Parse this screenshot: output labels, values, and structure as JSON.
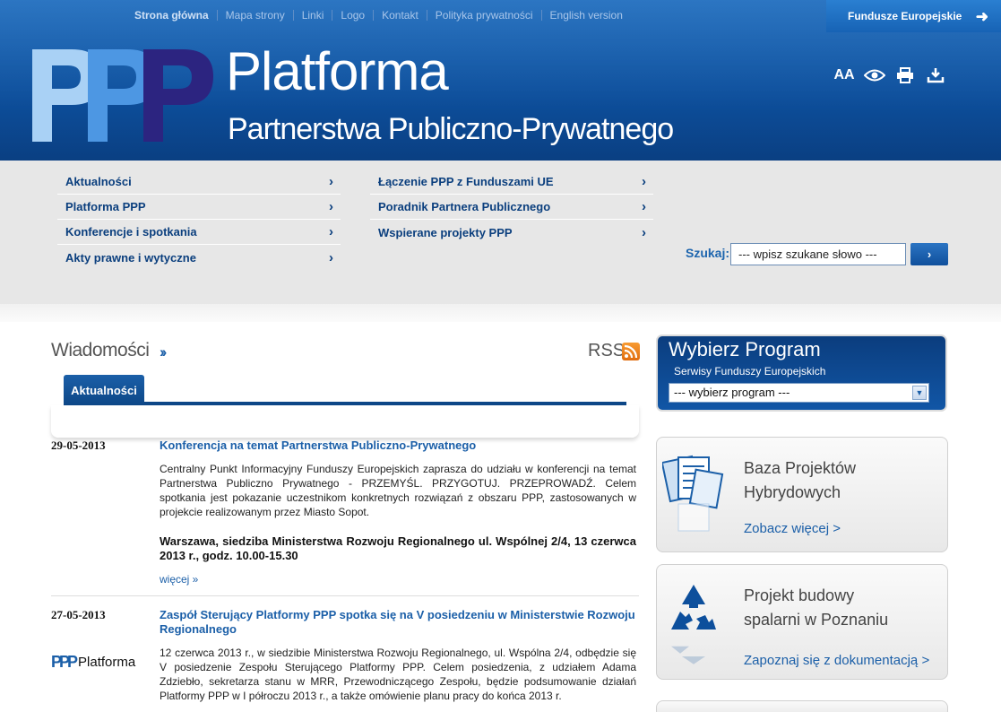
{
  "topnav": {
    "items": [
      "Strona główna",
      "Mapa strony",
      "Linki",
      "Logo",
      "Kontakt",
      "Polityka prywatności",
      "English version"
    ]
  },
  "fundusze": {
    "label": "Fundusze Europejskie"
  },
  "logo": {
    "line1": "Platforma",
    "line2": "Partnerstwa Publiczno-Prywatnego"
  },
  "tools": {
    "font_size": "AA",
    "icons": [
      "font-size-icon",
      "eye-icon",
      "print-icon",
      "download-icon"
    ]
  },
  "menu": {
    "left": [
      "Aktualności",
      "Platforma PPP",
      "Konferencje i spotkania",
      "Akty prawne i wytyczne"
    ],
    "right": [
      "Łączenie PPP z Funduszami UE",
      "Poradnik Partnera Publicznego",
      "Wspierane projekty PPP"
    ]
  },
  "search": {
    "label": "Szukaj:",
    "value": "--- wpisz szukane słowo ---",
    "button": "›"
  },
  "news": {
    "heading": "Wiadomości",
    "rss": "RSS",
    "tab": "Aktualności",
    "items": [
      {
        "date": "29-05-2013",
        "title": "Konferencja na temat Partnerstwa Publiczno-Prywatnego",
        "body": "Centralny Punkt Informacyjny Funduszy Europejskich zaprasza do udziału w konferencji na temat Partnerstwa Publiczno Prywatnego - PRZEMYŚL. PRZYGOTUJ. PRZEPROWADŹ. Celem spotkania jest pokazanie uczestnikom konkretnych rozwiązań z obszaru PPP, zastosowanych w projekcie realizowanym przez Miasto Sopot.",
        "bold": "Warszawa, siedziba Ministerstwa Rozwoju Regionalnego ul. Wspólnej 2/4, 13 czerwca 2013 r., godz. 10.00-15.30",
        "more": "więcej »"
      },
      {
        "date": "27-05-2013",
        "title": "Zaspół Sterujący Platformy PPP spotka się na V posiedzeniu w Ministerstwie Rozwoju Regionalnego",
        "body": "12 czerwca 2013 r., w siedzibie Ministerstwa Rozwoju Regionalnego, ul. Wspólna 2/4, odbędzie się V posiedzenie Zespołu Sterującego Platformy PPP. Celem posiedzenia, z udziałem Adama Zdziebło, sekretarza stanu w MRR, Przewodniczącego Zespołu, będzie podsumowanie działań Platformy PPP w I półroczu 2013 r., a także omówienie planu pracy do końca 2013 r.",
        "thumb_ppp": "PPP",
        "thumb_label": "Platforma"
      }
    ]
  },
  "program": {
    "title": "Wybierz Program",
    "subtitle": "Serwisy Funduszy Europejskich",
    "select_value": "--- wybierz program ---"
  },
  "boxes": [
    {
      "title_1": "Baza Projektów",
      "title_2": "Hybrydowych",
      "link": "Zobacz więcej >",
      "icon": "documents-icon"
    },
    {
      "title_1": "Projekt budowy",
      "title_2": "spalarni w Poznaniu",
      "link": "Zapoznaj się z dokumentacją >",
      "icon": "recycle-icon"
    }
  ]
}
